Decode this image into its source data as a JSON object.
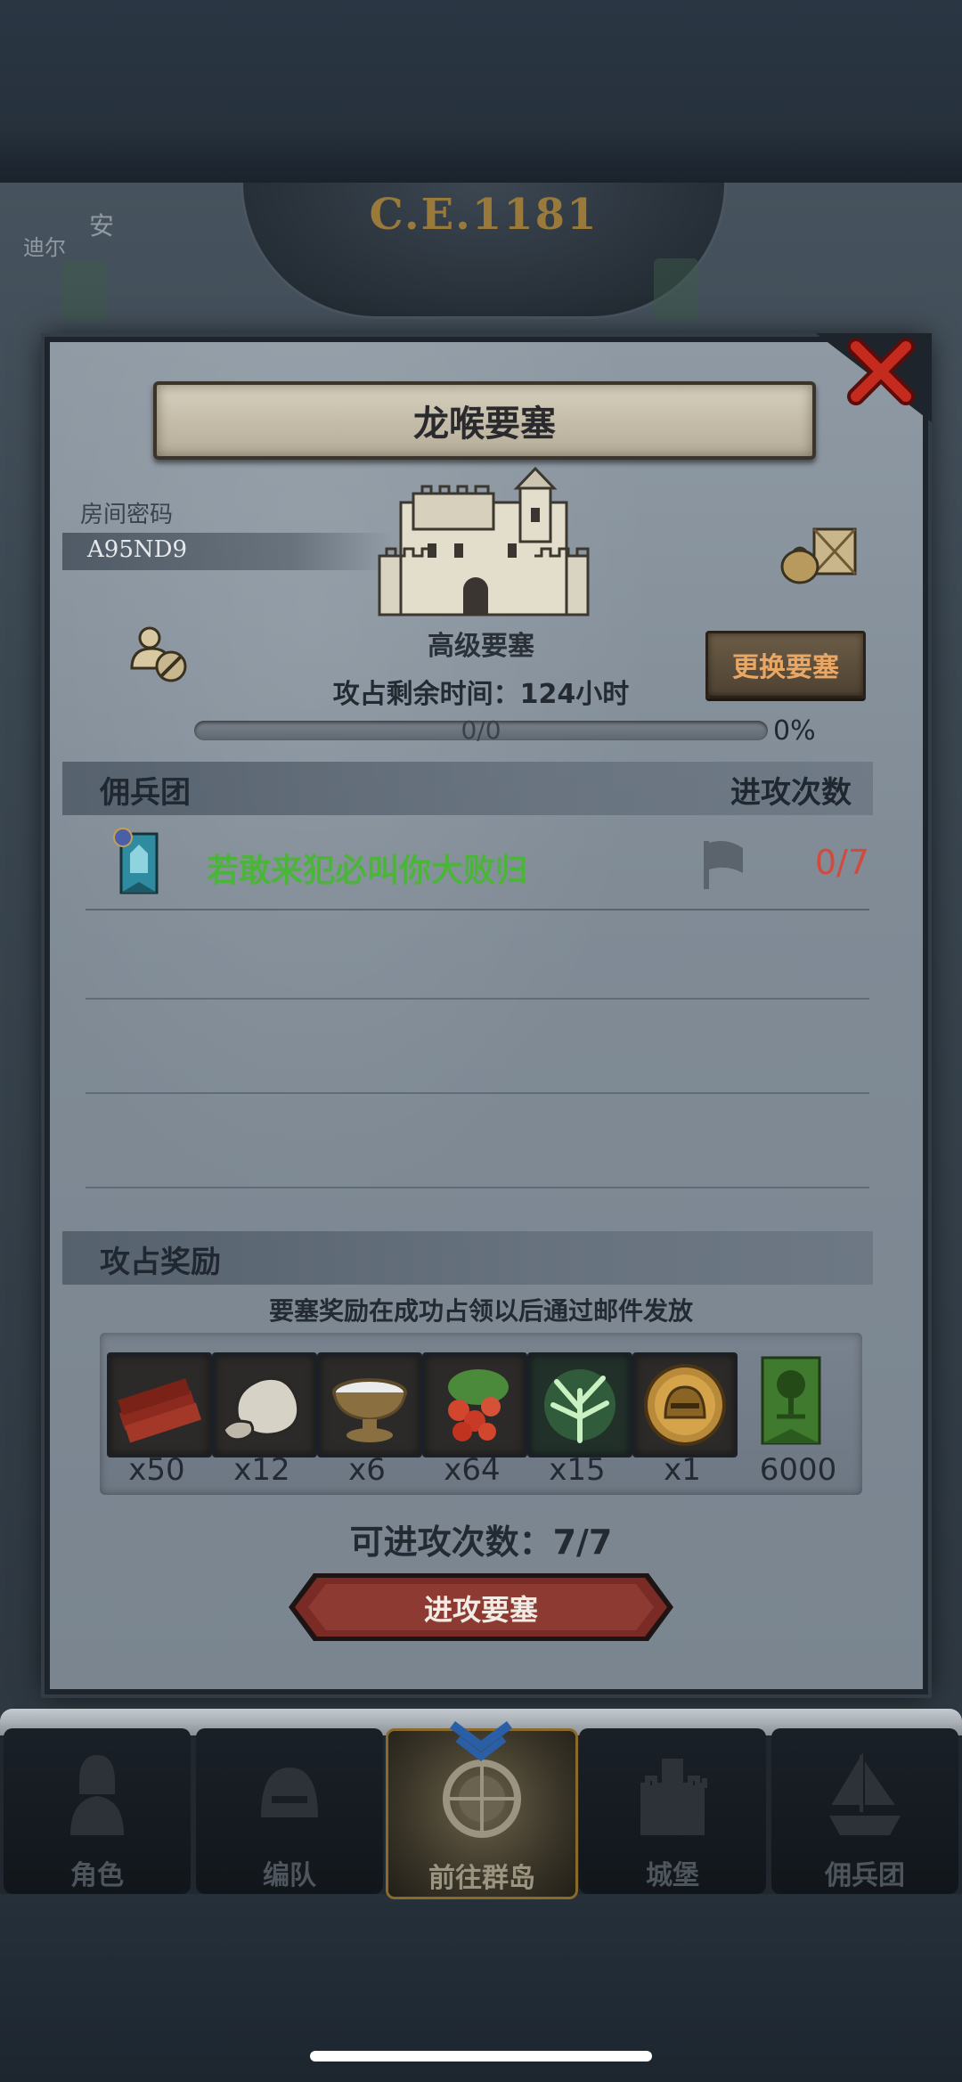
{
  "background": {
    "year": "C.E.1181",
    "left_labels": [
      "安",
      "迪尔"
    ]
  },
  "modal": {
    "title": "龙喉要塞",
    "room_password_label": "房间密码",
    "room_password": "A95ND9",
    "fortress_level": "高级要塞",
    "change_button": "更换要塞",
    "time_left": "攻占剩余时间：124小时",
    "progress_text": "0/0",
    "progress_percent": "0%",
    "progress_value": 0,
    "mercenary_section": "佣兵团",
    "attack_count_header": "进攻次数",
    "mercenaries": [
      {
        "name": "若敢来犯必叫你大败归",
        "count": "0/7"
      }
    ],
    "reward_section": "攻占奖励",
    "reward_note": "要塞奖励在成功占领以后通过邮件发放",
    "rewards": [
      {
        "icon": "wood-icon",
        "qty": "x50"
      },
      {
        "icon": "stone-icon",
        "qty": "x12"
      },
      {
        "icon": "milk-bowl-icon",
        "qty": "x6"
      },
      {
        "icon": "berries-icon",
        "qty": "x64"
      },
      {
        "icon": "herb-icon",
        "qty": "x15"
      },
      {
        "icon": "gold-helmet-coin-icon",
        "qty": "x1"
      },
      {
        "icon": "green-banner-icon",
        "qty": "6000"
      }
    ],
    "attempts": "可进攻次数：7/7",
    "attack_button": "进攻要塞"
  },
  "nav": {
    "tabs": [
      {
        "label": "角色",
        "icon": "knight-icon"
      },
      {
        "label": "编队",
        "icon": "helmet-icon"
      },
      {
        "label": "前往群岛",
        "icon": "compass-icon"
      },
      {
        "label": "城堡",
        "icon": "castle-icon"
      },
      {
        "label": "佣兵团",
        "icon": "ship-icon"
      }
    ],
    "active_index": 2
  },
  "colors": {
    "merc_name": "#4bb53a",
    "attack_count": "#d24a3c",
    "change_button_text": "#e9a766"
  }
}
